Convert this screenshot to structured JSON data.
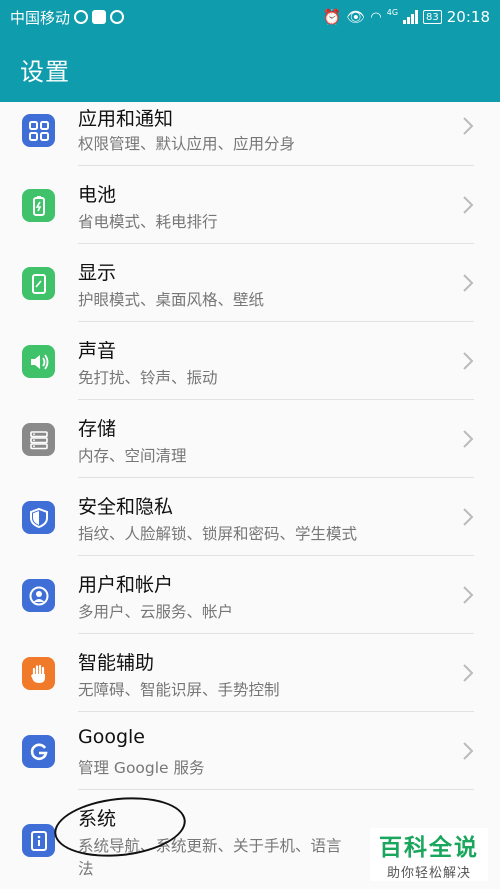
{
  "status": {
    "carrier": "中国移动",
    "battery": "83",
    "network": "4G",
    "time": "20:18"
  },
  "header": {
    "title": "设置"
  },
  "items": [
    {
      "title": "应用和通知",
      "subtitle": "权限管理、默认应用、应用分身",
      "icon": "apps-grid-icon",
      "color": "#3f6fd6"
    },
    {
      "title": "电池",
      "subtitle": "省电模式、耗电排行",
      "icon": "battery-icon",
      "color": "#3fc26a"
    },
    {
      "title": "显示",
      "subtitle": "护眼模式、桌面风格、壁纸",
      "icon": "display-icon",
      "color": "#3fc26a"
    },
    {
      "title": "声音",
      "subtitle": "免打扰、铃声、振动",
      "icon": "speaker-icon",
      "color": "#3fc26a"
    },
    {
      "title": "存储",
      "subtitle": "内存、空间清理",
      "icon": "storage-icon",
      "color": "#8a8a8a"
    },
    {
      "title": "安全和隐私",
      "subtitle": "指纹、人脸解锁、锁屏和密码、学生模式",
      "icon": "shield-icon",
      "color": "#3f6fd6"
    },
    {
      "title": "用户和帐户",
      "subtitle": "多用户、云服务、帐户",
      "icon": "user-icon",
      "color": "#3f6fd6"
    },
    {
      "title": "智能辅助",
      "subtitle": "无障碍、智能识屏、手势控制",
      "icon": "hand-icon",
      "color": "#f07a2a"
    },
    {
      "title": "Google",
      "subtitle": "管理 Google 服务",
      "icon": "google-icon",
      "color": "#3f6fd6"
    },
    {
      "title": "系统",
      "subtitle": "系统导航、系统更新、关于手机、语言",
      "subtitle2": "法",
      "icon": "info-icon",
      "color": "#3f6fd6"
    }
  ],
  "watermark": {
    "title": "百科全说",
    "subtitle": "助你轻松解决"
  }
}
